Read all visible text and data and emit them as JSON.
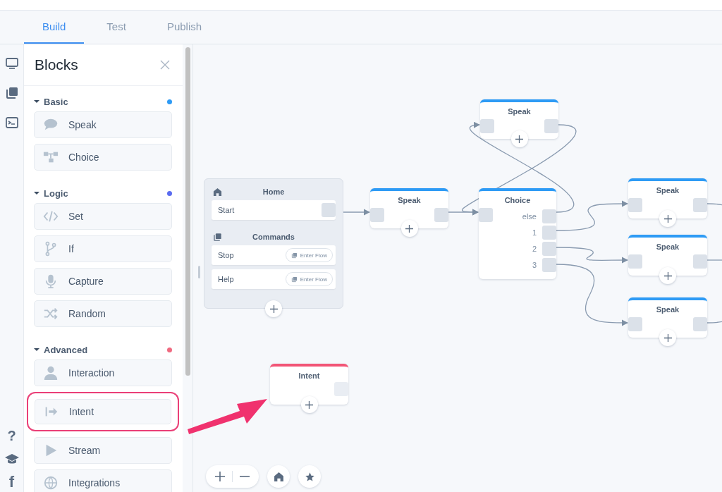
{
  "tabs": [
    {
      "label": "Build",
      "selected": true
    },
    {
      "label": "Test",
      "selected": false
    },
    {
      "label": "Publish",
      "selected": false
    }
  ],
  "rail": {
    "help": "?",
    "social": "f"
  },
  "panel": {
    "title": "Blocks",
    "sections": [
      {
        "label": "Basic",
        "color": "#2e9bf5",
        "expanded": true,
        "items": [
          {
            "label": "Speak",
            "kind": "speak",
            "highlighted": false
          },
          {
            "label": "Choice",
            "kind": "choice",
            "highlighted": false
          }
        ]
      },
      {
        "label": "Logic",
        "color": "#5b6cf0",
        "expanded": true,
        "items": [
          {
            "label": "Set",
            "kind": "set",
            "highlighted": false
          },
          {
            "label": "If",
            "kind": "if",
            "highlighted": false
          },
          {
            "label": "Capture",
            "kind": "capture",
            "highlighted": false
          },
          {
            "label": "Random",
            "kind": "random",
            "highlighted": false
          }
        ]
      },
      {
        "label": "Advanced",
        "color": "#f06a80",
        "expanded": true,
        "items": [
          {
            "label": "Interaction",
            "kind": "interaction",
            "highlighted": false
          },
          {
            "label": "Intent",
            "kind": "intent",
            "highlighted": true
          },
          {
            "label": "Stream",
            "kind": "stream",
            "highlighted": false
          },
          {
            "label": "Integrations",
            "kind": "integrations",
            "highlighted": false
          }
        ]
      }
    ]
  },
  "canvas": {
    "home": {
      "title": "Home",
      "start": "Start",
      "commands_title": "Commands",
      "commands": [
        {
          "label": "Stop",
          "action": "Enter Flow"
        },
        {
          "label": "Help",
          "action": "Enter Flow"
        }
      ]
    },
    "nodes": [
      {
        "kind": "speak",
        "title": "Speak",
        "color": "#2e9bf5"
      },
      {
        "kind": "speak",
        "title": "Speak",
        "color": "#2e9bf5"
      },
      {
        "kind": "choice",
        "title": "Choice",
        "color": "#2e9bf5",
        "outputs": [
          "else",
          "1",
          "2",
          "3"
        ]
      },
      {
        "kind": "speak",
        "title": "Speak",
        "color": "#2e9bf5"
      },
      {
        "kind": "speak",
        "title": "Speak",
        "color": "#2e9bf5"
      },
      {
        "kind": "speak",
        "title": "Speak",
        "color": "#2e9bf5"
      },
      {
        "kind": "intent",
        "title": "Intent",
        "color": "#f25576"
      }
    ]
  }
}
